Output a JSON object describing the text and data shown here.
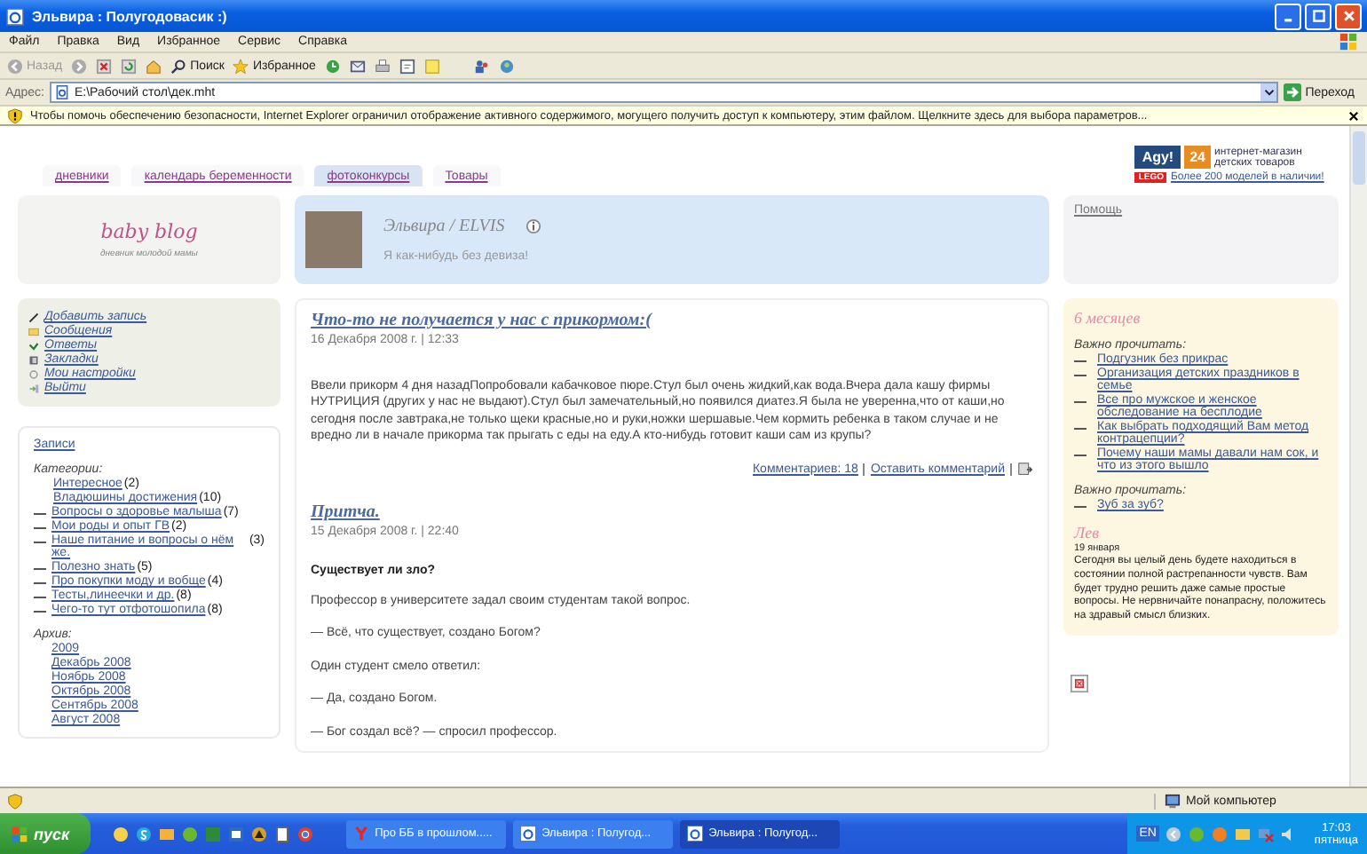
{
  "window": {
    "title": "Эльвира : Полугодовасик :)"
  },
  "menu": [
    "Файл",
    "Правка",
    "Вид",
    "Избранное",
    "Сервис",
    "Справка"
  ],
  "toolbar": {
    "back": "Назад",
    "search": "Поиск",
    "favorites": "Избранное"
  },
  "address": {
    "label": "Адрес:",
    "value": "E:\\Рабочий стол\\дек.mht",
    "go": "Переход"
  },
  "infobar": "Чтобы помочь обеспечению безопасности, Internet Explorer ограничил отображение активного содержимого, могущего получить доступ к компьютеру, этим файлом. Щелкните здесь для выбора параметров...",
  "tabs": [
    {
      "label": "дневники",
      "selected": false
    },
    {
      "label": "календарь беременности",
      "selected": false
    },
    {
      "label": "фотоконкурсы",
      "selected": true
    },
    {
      "label": "Товары",
      "selected": false
    }
  ],
  "ad": {
    "brand": "Agy!",
    "number": "24",
    "tagline": "интернет-магазин детских товаров",
    "lego": "LEGO",
    "link": "Более 200 моделей в наличии!"
  },
  "logo": {
    "title": "baby blog",
    "subtitle": "дневник молодой мамы"
  },
  "profile": {
    "name": "Эльвира / ELVIS",
    "motto": "Я как-нибудь без девиза!"
  },
  "help": "Помощь",
  "user_menu": [
    "Добавить запись",
    "Сообщения",
    "Ответы",
    "Закладки",
    "Мои настройки",
    "Выйти"
  ],
  "sidebar": {
    "entries": "Записи",
    "categories_label": "Категории:",
    "categories": [
      {
        "name": "Интересное",
        "count": "(2)",
        "dash": false
      },
      {
        "name": "Владюшины достижения",
        "count": "(10)",
        "dash": false
      },
      {
        "name": "Вопросы о здоровье малыша",
        "count": "(7)",
        "dash": true
      },
      {
        "name": "Мои роды и опыт ГВ",
        "count": "(2)",
        "dash": true
      },
      {
        "name": "Наше питание и вопросы о нём же.",
        "count": "(3)",
        "dash": true
      },
      {
        "name": "Полезно знать",
        "count": "(5)",
        "dash": true
      },
      {
        "name": "Про покупки моду и вобще",
        "count": "(4)",
        "dash": true
      },
      {
        "name": "Тесты,линеечки и др.",
        "count": "(8)",
        "dash": true
      },
      {
        "name": "Чего-то тут отфотошопила",
        "count": "(8)",
        "dash": true
      }
    ],
    "archive_label": "Архив:",
    "archive": [
      "2009",
      "Декабрь 2008",
      "Ноябрь 2008",
      "Октябрь 2008",
      "Сентябрь 2008",
      "Август 2008"
    ]
  },
  "posts": [
    {
      "title": "Что-то не получается у нас с прикормом:(",
      "date": "16 Декабря 2008 г. | 12:33",
      "body": [
        {
          "kind": "paragraph",
          "text": "Ввели прикорм 4 дня назадПопробовали кабачковое пюре.Стул был очень жидкий,как вода.Вчера дала кашу фирмы НУТРИЦИЯ (других у нас не выдают).Стул был замечательный,но появился диатез.Я была не уверенна,что от каши,но сегодня после завтрака,не только щеки красные,но и руки,ножки шершавые.Чем кормить ребенка в таком случае и не вредно ли в начале прикорма так прыгать с еды на еду.А кто-нибудь готовит каши сам из крупы?"
        }
      ],
      "comments": "Комментариев: 18",
      "leave_comment": "Оставить комментарий"
    },
    {
      "title": "Притча.",
      "date": "15 Декабря 2008 г. | 22:40",
      "body": [
        {
          "kind": "heading",
          "text": "Существует ли зло?"
        },
        {
          "kind": "paragraph",
          "text": "Профессор в университете задал своим студентам такой вопрос."
        },
        {
          "kind": "paragraph",
          "text": "— Всё, что существует, создано Богом?"
        },
        {
          "kind": "paragraph",
          "text": "Один студент смело ответил:"
        },
        {
          "kind": "paragraph",
          "text": "— Да, создано Богом."
        },
        {
          "kind": "paragraph",
          "text": "— Бог создал всё? — спросил профессор."
        }
      ]
    }
  ],
  "reading": {
    "age": "6 месяцев",
    "groups": [
      {
        "label": "Важно прочитать:",
        "links": [
          "Подгузник без прикрас",
          "Организация детских праздников в семье",
          "Все про мужское и женское обследование на бесплодие",
          "Как выбрать подходящий Вам метод контрацепции?",
          "Почему наши мамы давали нам сок, и что из этого вышло"
        ]
      },
      {
        "label": "Важно прочитать:",
        "links": [
          "Зуб за зуб?"
        ]
      }
    ],
    "horoscope": {
      "sign": "Лев",
      "date": "19 января",
      "text": "Сегодня вы целый день будете находиться в состоянии полной растрепанности чувств. Вам будет трудно решить даже самые простые вопросы. Не нервничайте понапрасну, положитесь на здравый смысл близких."
    }
  },
  "status": "Мой компьютер",
  "taskbar": {
    "start": "пуск",
    "tasks": [
      {
        "label": "Про ББ в прошлом.....",
        "selected": false
      },
      {
        "label": "Эльвира : Полугод...",
        "selected": false
      },
      {
        "label": "Эльвира : Полугод...",
        "selected": true
      }
    ],
    "lang": "EN",
    "clock": "17:03",
    "day": "пятница"
  }
}
